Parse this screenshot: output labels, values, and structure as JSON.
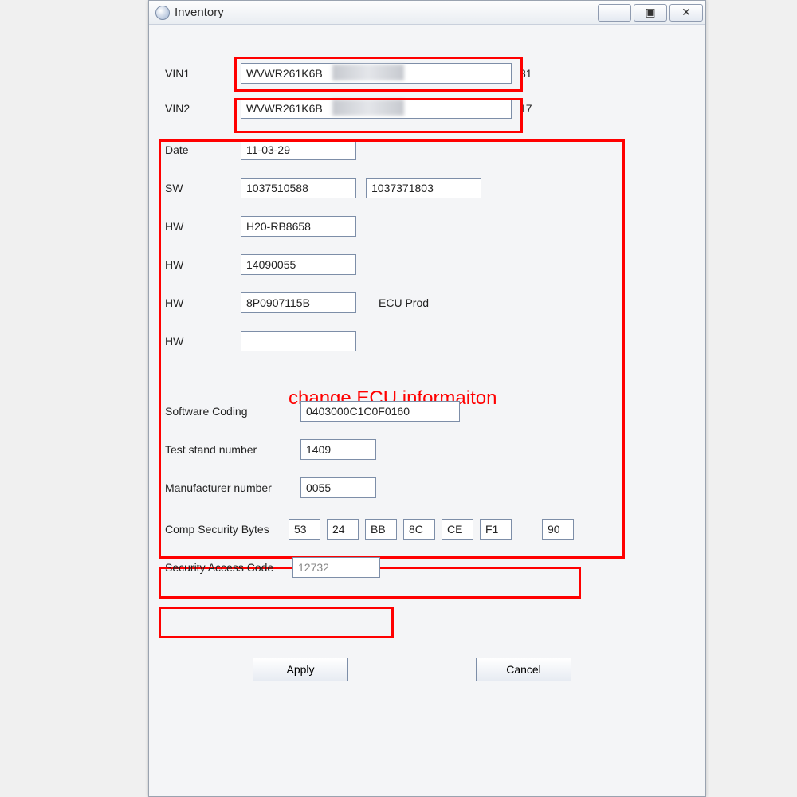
{
  "window": {
    "title": "Inventory"
  },
  "fields": {
    "vin1_label": "VIN1",
    "vin1_value": "WVWR261K6B",
    "vin1_suffix": "31",
    "vin2_label": "VIN2",
    "vin2_value": "WVWR261K6B",
    "vin2_suffix": "17",
    "date_label": "Date",
    "date_value": "11-03-29",
    "sw_label": "SW",
    "sw_value1": "1037510588",
    "sw_value2": "1037371803",
    "hw1_label": "HW",
    "hw1_value": "H20-RB8658",
    "hw2_label": "HW",
    "hw2_value": "14090055",
    "hw3_label": "HW",
    "hw3_value": "8P0907115B",
    "ecu_prod_label": "ECU Prod",
    "hw4_label": "HW",
    "hw4_value": "",
    "swcoding_label": "Software Coding",
    "swcoding_value": "0403000C1C0F0160",
    "teststand_label": "Test stand number",
    "teststand_value": "1409",
    "manuf_label": "Manufacturer number",
    "manuf_value": "0055",
    "compsec_label": "Comp Security Bytes",
    "compsec_bytes": [
      "53",
      "24",
      "BB",
      "8C",
      "CE",
      "F1",
      "90"
    ],
    "secaccess_label": "Security Access Code",
    "secaccess_value": "12732"
  },
  "annotation": "change ECU informaiton",
  "buttons": {
    "apply": "Apply",
    "cancel": "Cancel"
  }
}
